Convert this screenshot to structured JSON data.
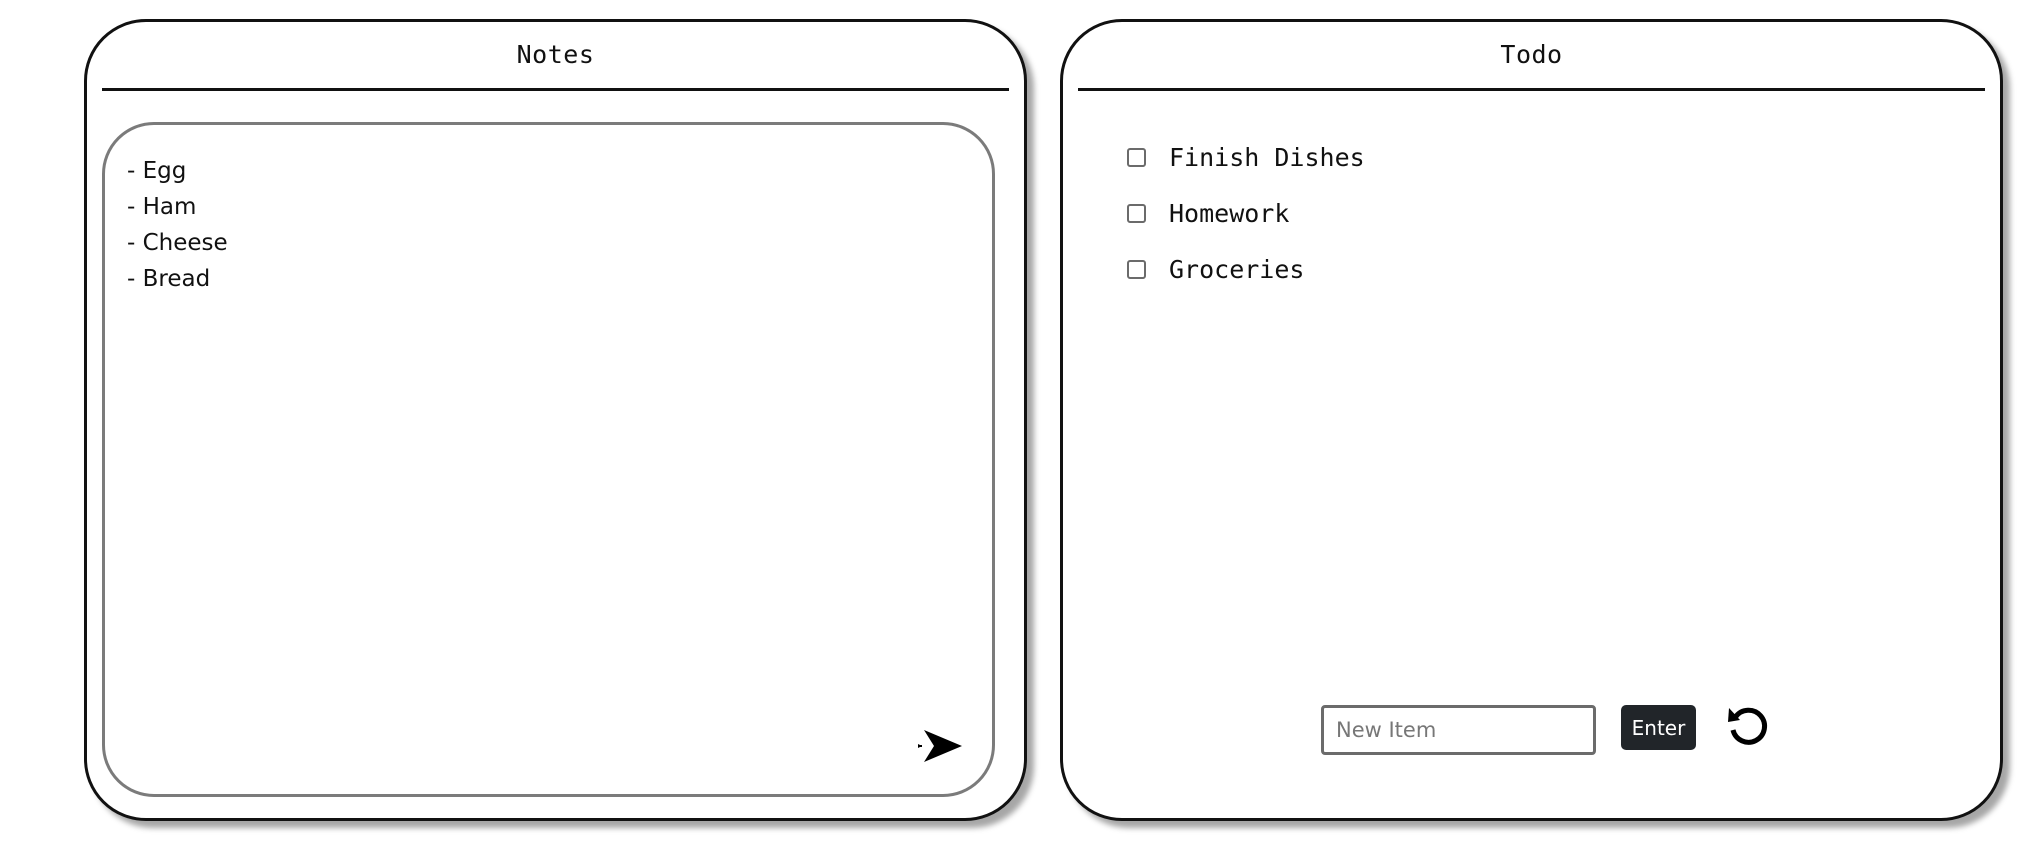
{
  "notes": {
    "title": "Notes",
    "content": "- Egg\n- Ham\n- Cheese\n- Bread",
    "send_icon": "send-arrow-icon"
  },
  "todo": {
    "title": "Todo",
    "items": [
      {
        "label": "Finish Dishes",
        "checked": false
      },
      {
        "label": "Homework",
        "checked": false
      },
      {
        "label": "Groceries",
        "checked": false
      }
    ],
    "input_value": "",
    "input_placeholder": "New Item",
    "enter_label": "Enter",
    "reset_icon": "rotate-ccw-icon"
  },
  "colors": {
    "border": "#111111",
    "textarea_border": "#7b7b7b",
    "button_bg": "#212529",
    "button_text": "#ffffff"
  }
}
